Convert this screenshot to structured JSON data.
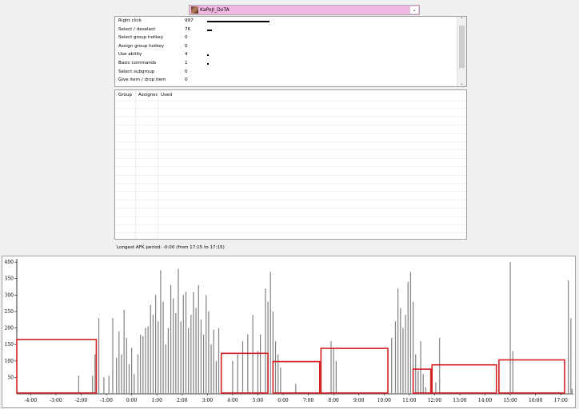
{
  "player": {
    "name": "KaPoJI_DoTA"
  },
  "actions": [
    {
      "label": "Right click",
      "value": "997",
      "count": 997
    },
    {
      "label": "Select / deselect",
      "value": "76",
      "count": 76
    },
    {
      "label": "Select group hotkey",
      "value": "0",
      "count": 0
    },
    {
      "label": "Assign group hotkey",
      "value": "0",
      "count": 0
    },
    {
      "label": "Use ability",
      "value": "4",
      "count": 4
    },
    {
      "label": "Basic commands",
      "value": "1",
      "count": 1
    },
    {
      "label": "Select subgroup",
      "value": "0",
      "count": 0
    },
    {
      "label": "Give item / drop item",
      "value": "0",
      "count": 0
    }
  ],
  "hotkey_table": {
    "columns": [
      "Group",
      "Assigned",
      "Used"
    ],
    "rows": []
  },
  "afk": {
    "text": "Longest AFK period: -0:00 (from 17:15 to 17:15)"
  },
  "chart_data": {
    "type": "bar",
    "ylim": [
      0,
      410
    ],
    "xlim": [
      -4.55,
      17.5
    ],
    "yticks": [
      50,
      100,
      150,
      200,
      250,
      300,
      350,
      400
    ],
    "xticks": [
      {
        "v": -4,
        "label": "-4:00"
      },
      {
        "v": -3,
        "label": "-3:00"
      },
      {
        "v": -2,
        "label": "-2:00"
      },
      {
        "v": -1,
        "label": "-1:00"
      },
      {
        "v": 0,
        "label": "0:00"
      },
      {
        "v": 1,
        "label": "1:00"
      },
      {
        "v": 2,
        "label": "2:00"
      },
      {
        "v": 3,
        "label": "3:00"
      },
      {
        "v": 4,
        "label": "4:00"
      },
      {
        "v": 5,
        "label": "5:00"
      },
      {
        "v": 6,
        "label": "6:00"
      },
      {
        "v": 7,
        "label": "7:00"
      },
      {
        "v": 8,
        "label": "8:00"
      },
      {
        "v": 9,
        "label": "9:00"
      },
      {
        "v": 10,
        "label": "10:00"
      },
      {
        "v": 11,
        "label": "11:00"
      },
      {
        "v": 12,
        "label": "12:00"
      },
      {
        "v": 13,
        "label": "13:00"
      },
      {
        "v": 14,
        "label": "14:00"
      },
      {
        "v": 15,
        "label": "15:00"
      },
      {
        "v": 16,
        "label": "16:00"
      },
      {
        "v": 17,
        "label": "17:00"
      }
    ],
    "bars": [
      {
        "x": -2.1,
        "y": 55
      },
      {
        "x": -1.55,
        "y": 55
      },
      {
        "x": -1.45,
        "y": 120
      },
      {
        "x": -1.3,
        "y": 230
      },
      {
        "x": -1.1,
        "y": 50
      },
      {
        "x": -0.9,
        "y": 55
      },
      {
        "x": -0.75,
        "y": 230
      },
      {
        "x": -0.6,
        "y": 110
      },
      {
        "x": -0.5,
        "y": 190
      },
      {
        "x": -0.4,
        "y": 120
      },
      {
        "x": -0.3,
        "y": 255
      },
      {
        "x": -0.2,
        "y": 170
      },
      {
        "x": -0.1,
        "y": 90
      },
      {
        "x": 0.0,
        "y": 140
      },
      {
        "x": 0.1,
        "y": 60
      },
      {
        "x": 0.25,
        "y": 120
      },
      {
        "x": 0.35,
        "y": 180
      },
      {
        "x": 0.45,
        "y": 175
      },
      {
        "x": 0.55,
        "y": 200
      },
      {
        "x": 0.65,
        "y": 205
      },
      {
        "x": 0.75,
        "y": 270
      },
      {
        "x": 0.85,
        "y": 240
      },
      {
        "x": 0.95,
        "y": 300
      },
      {
        "x": 1.05,
        "y": 220
      },
      {
        "x": 1.15,
        "y": 375
      },
      {
        "x": 1.25,
        "y": 280
      },
      {
        "x": 1.35,
        "y": 150
      },
      {
        "x": 1.45,
        "y": 200
      },
      {
        "x": 1.55,
        "y": 330
      },
      {
        "x": 1.65,
        "y": 290
      },
      {
        "x": 1.75,
        "y": 245
      },
      {
        "x": 1.85,
        "y": 380
      },
      {
        "x": 1.95,
        "y": 220
      },
      {
        "x": 2.05,
        "y": 300
      },
      {
        "x": 2.15,
        "y": 310
      },
      {
        "x": 2.25,
        "y": 200
      },
      {
        "x": 2.35,
        "y": 240
      },
      {
        "x": 2.45,
        "y": 310
      },
      {
        "x": 2.55,
        "y": 260
      },
      {
        "x": 2.65,
        "y": 330
      },
      {
        "x": 2.75,
        "y": 225
      },
      {
        "x": 2.85,
        "y": 180
      },
      {
        "x": 2.95,
        "y": 300
      },
      {
        "x": 3.05,
        "y": 250
      },
      {
        "x": 3.15,
        "y": 150
      },
      {
        "x": 3.25,
        "y": 195
      },
      {
        "x": 3.35,
        "y": 100
      },
      {
        "x": 3.45,
        "y": 200
      },
      {
        "x": 4.0,
        "y": 100
      },
      {
        "x": 4.2,
        "y": 120
      },
      {
        "x": 4.4,
        "y": 160
      },
      {
        "x": 4.6,
        "y": 180
      },
      {
        "x": 4.8,
        "y": 240
      },
      {
        "x": 5.0,
        "y": 130
      },
      {
        "x": 5.1,
        "y": 180
      },
      {
        "x": 5.3,
        "y": 320
      },
      {
        "x": 5.4,
        "y": 280
      },
      {
        "x": 5.5,
        "y": 370
      },
      {
        "x": 5.6,
        "y": 250
      },
      {
        "x": 5.7,
        "y": 160
      },
      {
        "x": 5.8,
        "y": 120
      },
      {
        "x": 5.9,
        "y": 80
      },
      {
        "x": 6.5,
        "y": 30
      },
      {
        "x": 7.9,
        "y": 160
      },
      {
        "x": 8.0,
        "y": 140
      },
      {
        "x": 8.1,
        "y": 100
      },
      {
        "x": 10.3,
        "y": 170
      },
      {
        "x": 10.45,
        "y": 220
      },
      {
        "x": 10.55,
        "y": 320
      },
      {
        "x": 10.65,
        "y": 260
      },
      {
        "x": 10.75,
        "y": 200
      },
      {
        "x": 10.85,
        "y": 240
      },
      {
        "x": 10.95,
        "y": 340
      },
      {
        "x": 11.05,
        "y": 370
      },
      {
        "x": 11.15,
        "y": 280
      },
      {
        "x": 11.25,
        "y": 120
      },
      {
        "x": 11.35,
        "y": 70
      },
      {
        "x": 11.45,
        "y": 160
      },
      {
        "x": 11.55,
        "y": 60
      },
      {
        "x": 11.65,
        "y": 20
      },
      {
        "x": 12.05,
        "y": 35
      },
      {
        "x": 12.2,
        "y": 170
      },
      {
        "x": 15.0,
        "y": 400
      },
      {
        "x": 15.1,
        "y": 130
      },
      {
        "x": 17.3,
        "y": 345
      },
      {
        "x": 17.4,
        "y": 230
      },
      {
        "x": 17.45,
        "y": 15
      }
    ],
    "afk_periods": [
      {
        "x0": -4.55,
        "x1": -1.4,
        "ymax": 165
      },
      {
        "x0": 3.55,
        "x1": 5.4,
        "ymax": 123
      },
      {
        "x0": 5.6,
        "x1": 7.45,
        "ymax": 98
      },
      {
        "x0": 7.5,
        "x1": 10.15,
        "ymax": 138
      },
      {
        "x0": 11.15,
        "x1": 11.85,
        "ymax": 75
      },
      {
        "x0": 11.9,
        "x1": 14.45,
        "ymax": 88
      },
      {
        "x0": 14.55,
        "x1": 17.15,
        "ymax": 103
      }
    ],
    "colors": {
      "bar": "#808080",
      "afk_box": "#d42020"
    }
  }
}
